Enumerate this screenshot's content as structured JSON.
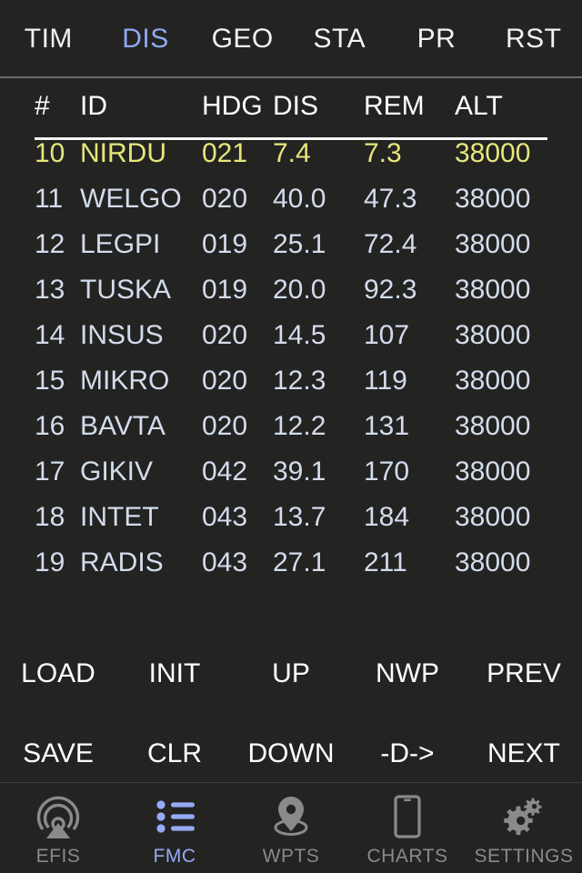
{
  "topbar": {
    "items": [
      {
        "label": "TIM",
        "active": false
      },
      {
        "label": "DIS",
        "active": true
      },
      {
        "label": "GEO",
        "active": false
      },
      {
        "label": "STA",
        "active": false
      },
      {
        "label": "PR",
        "active": false
      },
      {
        "label": "RST",
        "active": false
      }
    ]
  },
  "table": {
    "headers": {
      "num": "#",
      "id": "ID",
      "hdg": "HDG",
      "dis": "DIS",
      "rem": "REM",
      "alt": "ALT"
    },
    "rows": [
      {
        "num": "10",
        "id": "NIRDU",
        "hdg": "021",
        "dis": "7.4",
        "rem": "7.3",
        "alt": "38000",
        "active": true
      },
      {
        "num": "11",
        "id": "WELGO",
        "hdg": "020",
        "dis": "40.0",
        "rem": "47.3",
        "alt": "38000",
        "active": false
      },
      {
        "num": "12",
        "id": "LEGPI",
        "hdg": "019",
        "dis": "25.1",
        "rem": "72.4",
        "alt": "38000",
        "active": false
      },
      {
        "num": "13",
        "id": "TUSKA",
        "hdg": "019",
        "dis": "20.0",
        "rem": "92.3",
        "alt": "38000",
        "active": false
      },
      {
        "num": "14",
        "id": "INSUS",
        "hdg": "020",
        "dis": "14.5",
        "rem": "107",
        "alt": "38000",
        "active": false
      },
      {
        "num": "15",
        "id": "MIKRO",
        "hdg": "020",
        "dis": "12.3",
        "rem": "119",
        "alt": "38000",
        "active": false
      },
      {
        "num": "16",
        "id": "BAVTA",
        "hdg": "020",
        "dis": "12.2",
        "rem": "131",
        "alt": "38000",
        "active": false
      },
      {
        "num": "17",
        "id": "GIKIV",
        "hdg": "042",
        "dis": "39.1",
        "rem": "170",
        "alt": "38000",
        "active": false
      },
      {
        "num": "18",
        "id": "INTET",
        "hdg": "043",
        "dis": "13.7",
        "rem": "184",
        "alt": "38000",
        "active": false
      },
      {
        "num": "19",
        "id": "RADIS",
        "hdg": "043",
        "dis": "27.1",
        "rem": "211",
        "alt": "38000",
        "active": false
      }
    ]
  },
  "actions": {
    "row1": [
      "LOAD",
      "INIT",
      "UP",
      "NWP",
      "PREV"
    ],
    "row2": [
      "SAVE",
      "CLR",
      "DOWN",
      "-D->",
      "NEXT"
    ]
  },
  "tabbar": {
    "items": [
      {
        "label": "EFIS",
        "icon": "radar-beacon-icon",
        "active": false
      },
      {
        "label": "FMC",
        "icon": "bullet-list-icon",
        "active": true
      },
      {
        "label": "WPTS",
        "icon": "map-pin-icon",
        "active": false
      },
      {
        "label": "CHARTS",
        "icon": "tablet-icon",
        "active": false
      },
      {
        "label": "SETTINGS",
        "icon": "gears-icon",
        "active": false
      }
    ]
  },
  "colors": {
    "background": "#232322",
    "accent_blue": "#8fa8f0",
    "active_row_yellow": "#e6e67c",
    "row_text": "#d3dcec",
    "header_text": "#ffffff",
    "inactive_tab": "#8a8a8a"
  }
}
